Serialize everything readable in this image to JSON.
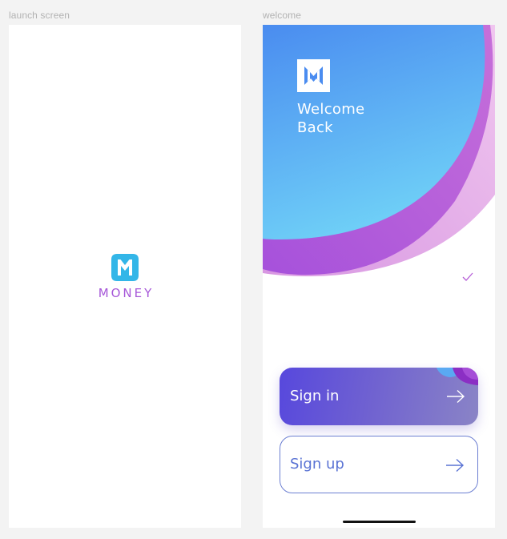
{
  "frames": {
    "launch": {
      "label": "launch screen",
      "brand": "MONEY",
      "logo_icon": "money-logo-icon"
    },
    "welcome": {
      "label": "welcome",
      "logo_icon": "money-logo-icon",
      "title_line1": "Welcome",
      "title_line2": "Back",
      "check_icon": "check-icon",
      "signin_label": "Sign in",
      "signup_label": "Sign up",
      "arrow_icon": "arrow-right-icon"
    }
  },
  "colors": {
    "page_bg": "#f3f3f3",
    "frame_label": "#b2b2b2",
    "brand_purple": "#a657d8",
    "logo_blue": "#33b6e8",
    "hero_blue_top": "#4a8cf0",
    "hero_blue_bottom": "#6fd0f7",
    "hero_purple": "#a651db",
    "hero_pink": "#e9b8ec",
    "signin_start": "#5748dd",
    "signin_end": "#8a84c6",
    "signup_border": "#6c7fd2",
    "signup_text": "#5a73d4",
    "home_indicator": "#111111"
  }
}
